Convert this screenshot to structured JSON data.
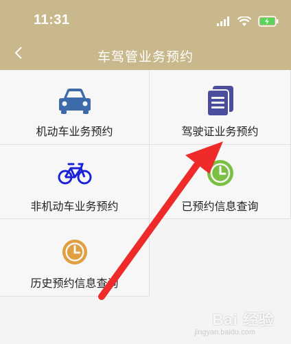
{
  "status_bar": {
    "time": "11:31"
  },
  "header": {
    "title": "车驾管业务预约"
  },
  "services": [
    {
      "label": "机动车业务预约",
      "icon": "car-icon",
      "color": "#3d6aa8"
    },
    {
      "label": "驾驶证业务预约",
      "icon": "document-icon",
      "color": "#4a4e9c"
    },
    {
      "label": "非机动车业务预约",
      "icon": "bicycle-icon",
      "color": "#1a22d6"
    },
    {
      "label": "已预约信息查询",
      "icon": "clock-icon",
      "color": "#7cc043"
    },
    {
      "label": "历史预约信息查询",
      "icon": "clock-icon",
      "color": "#e0a040"
    }
  ],
  "colors": {
    "header_bg": "#c8b88c",
    "arrow": "#ee2a2a"
  },
  "watermark": {
    "text": "Bai 经验",
    "sub": "jingyan.baidu.com"
  }
}
